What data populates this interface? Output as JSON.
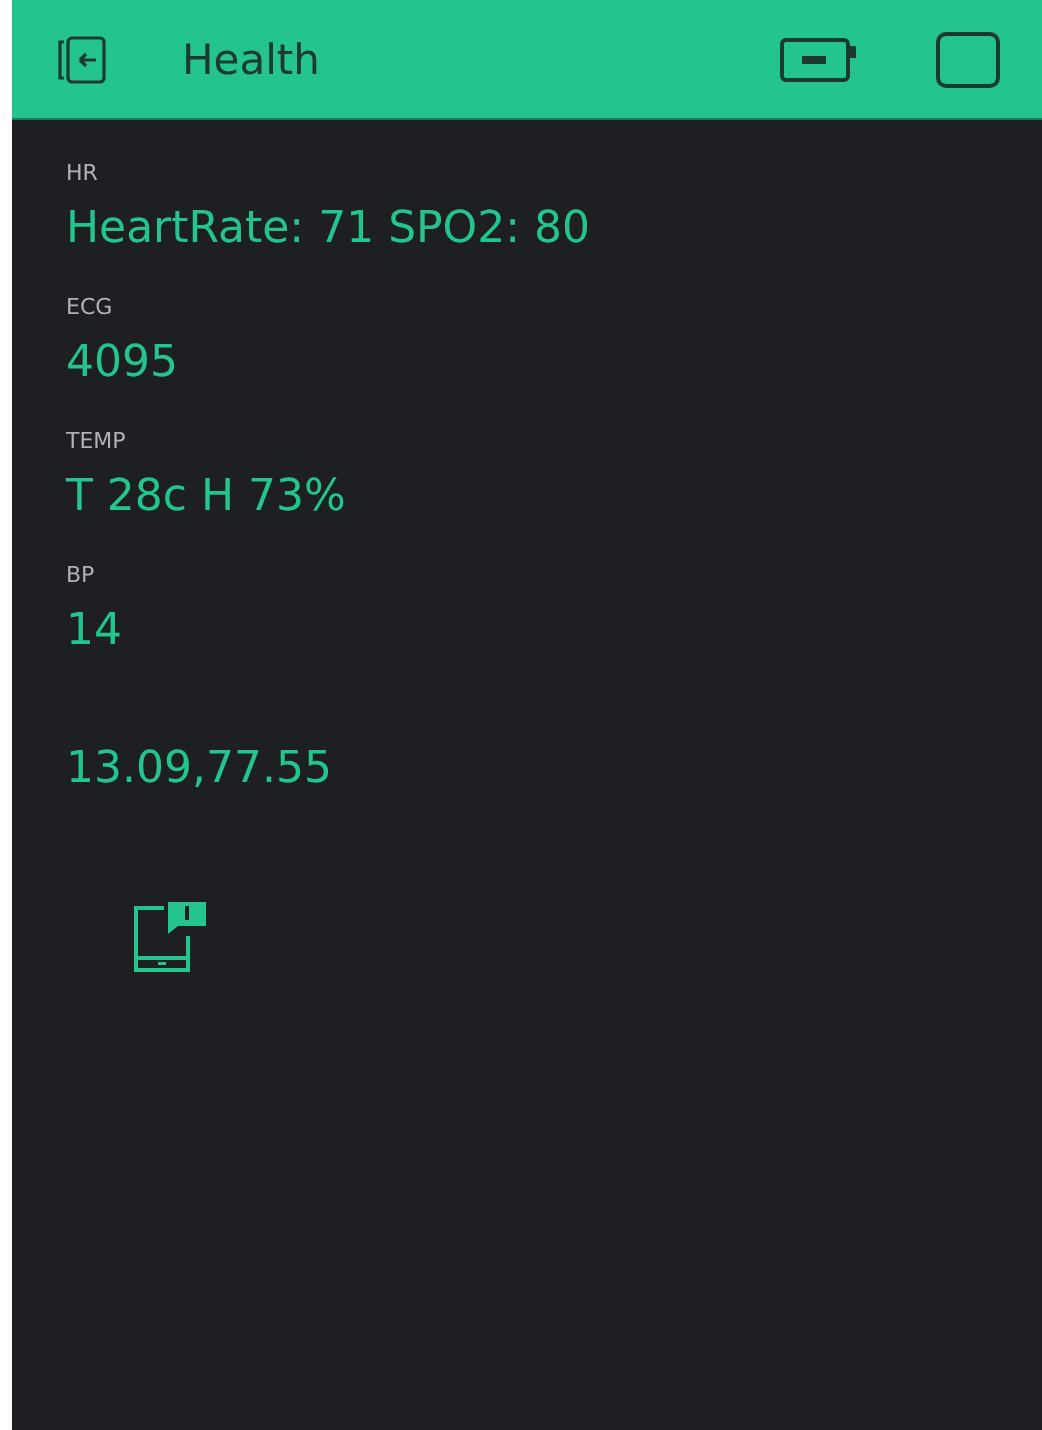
{
  "header": {
    "title": "Health"
  },
  "widgets": [
    {
      "label": "HR",
      "value": "HeartRate: 71 SPO2: 80"
    },
    {
      "label": "ECG",
      "value": "4095"
    },
    {
      "label": "TEMP",
      "value": "T 28c H 73%"
    },
    {
      "label": "BP",
      "value": "14"
    },
    {
      "value": "13.09,77.55"
    }
  ]
}
